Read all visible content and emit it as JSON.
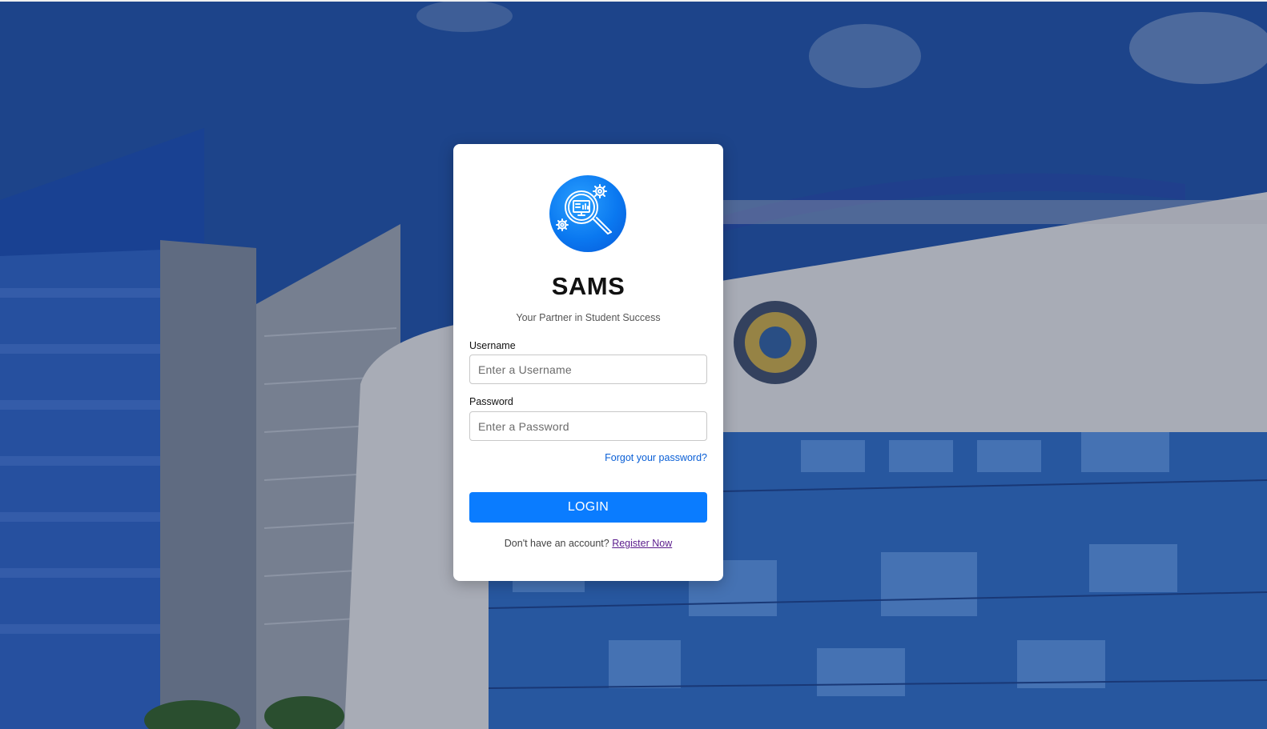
{
  "app": {
    "title": "SAMS",
    "tagline": "Your Partner in Student Success"
  },
  "form": {
    "username_label": "Username",
    "username_placeholder": "Enter a Username",
    "username_value": "",
    "password_label": "Password",
    "password_placeholder": "Enter a Password",
    "password_value": "",
    "forgot_link": "Forgot your password?",
    "login_button": "LOGIN",
    "no_account_text": "Don't have an account?",
    "register_link": "Register Now"
  },
  "icons": {
    "logo": "analytics-magnifier-icon"
  },
  "colors": {
    "primary": "#0a7cff",
    "link": "#0a5fd6",
    "visited_link": "#5a1b8c",
    "card_bg": "#ffffff"
  }
}
